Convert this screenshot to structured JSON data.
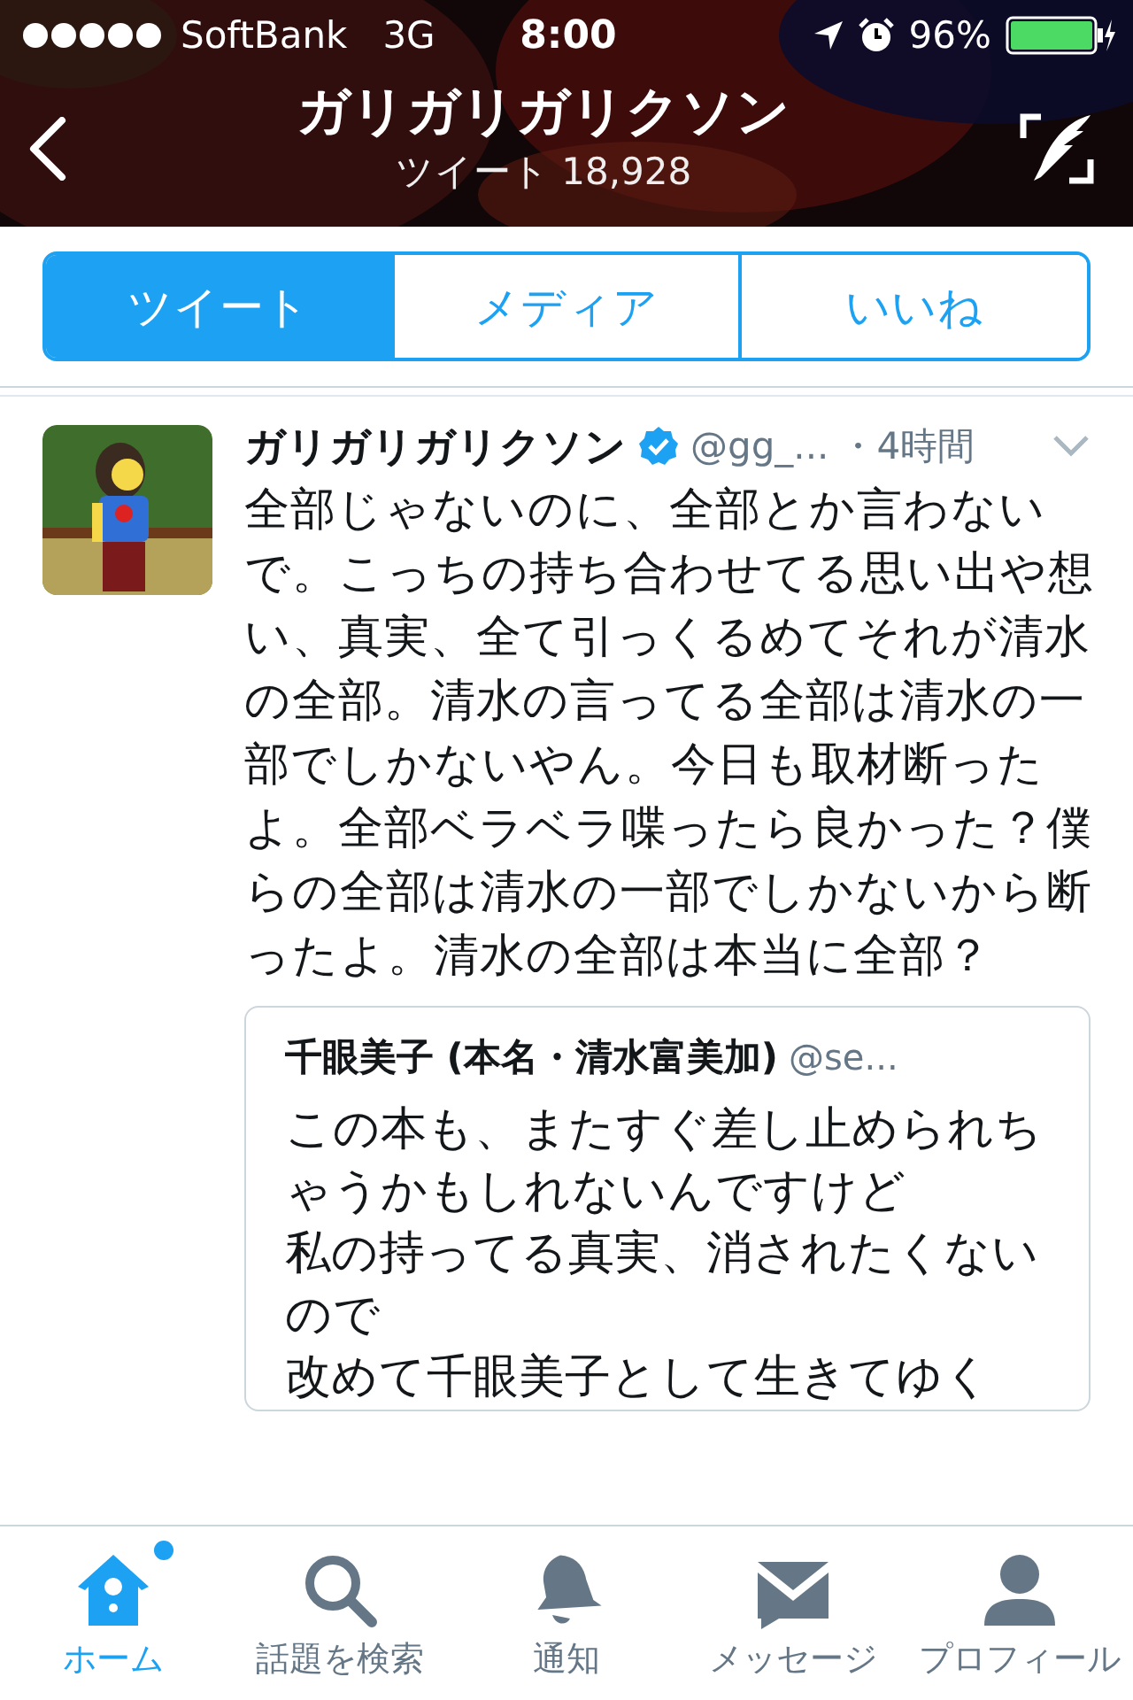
{
  "status_bar": {
    "carrier": "SoftBank",
    "network": "3G",
    "time": "8:00",
    "battery": "96%"
  },
  "header": {
    "title": "ガリガリガリクソン",
    "subtitle": "ツイート 18,928"
  },
  "tabs": [
    {
      "label": "ツイート",
      "selected": true
    },
    {
      "label": "メディア",
      "selected": false
    },
    {
      "label": "いいね",
      "selected": false
    }
  ],
  "tweet": {
    "name": "ガリガリガリクソン",
    "verified": true,
    "handle": "@gg_...",
    "time": "・4時間",
    "text": "全部じゃないのに、全部とか言わないで。こっちの持ち合わせてる思い出や想い、真実、全て引っくるめてそれが清水の全部。清水の言ってる全部は清水の一部でしかないやん。今日も取材断ったよ。全部ベラベラ喋ったら良かった？僕らの全部は清水の一部でしかないから断ったよ。清水の全部は本当に全部？",
    "quote": {
      "name": "千眼美子 (本名・清水富美加)",
      "handle": "@se...",
      "lines": [
        "この本も、またすぐ差し止められちゃうかもしれないんですけど",
        "私の持ってる真実、消されたくないので",
        "改めて千眼美子として生きてゆく"
      ]
    }
  },
  "tab_bar": [
    {
      "kind": "home",
      "label": "ホーム",
      "selected": true,
      "dot": true
    },
    {
      "kind": "search",
      "label": "話題を検索",
      "selected": false,
      "dot": false
    },
    {
      "kind": "bell",
      "label": "通知",
      "selected": false,
      "dot": false
    },
    {
      "kind": "mail",
      "label": "メッセージ",
      "selected": false,
      "dot": false
    },
    {
      "kind": "person",
      "label": "プロフィール",
      "selected": false,
      "dot": false
    }
  ]
}
